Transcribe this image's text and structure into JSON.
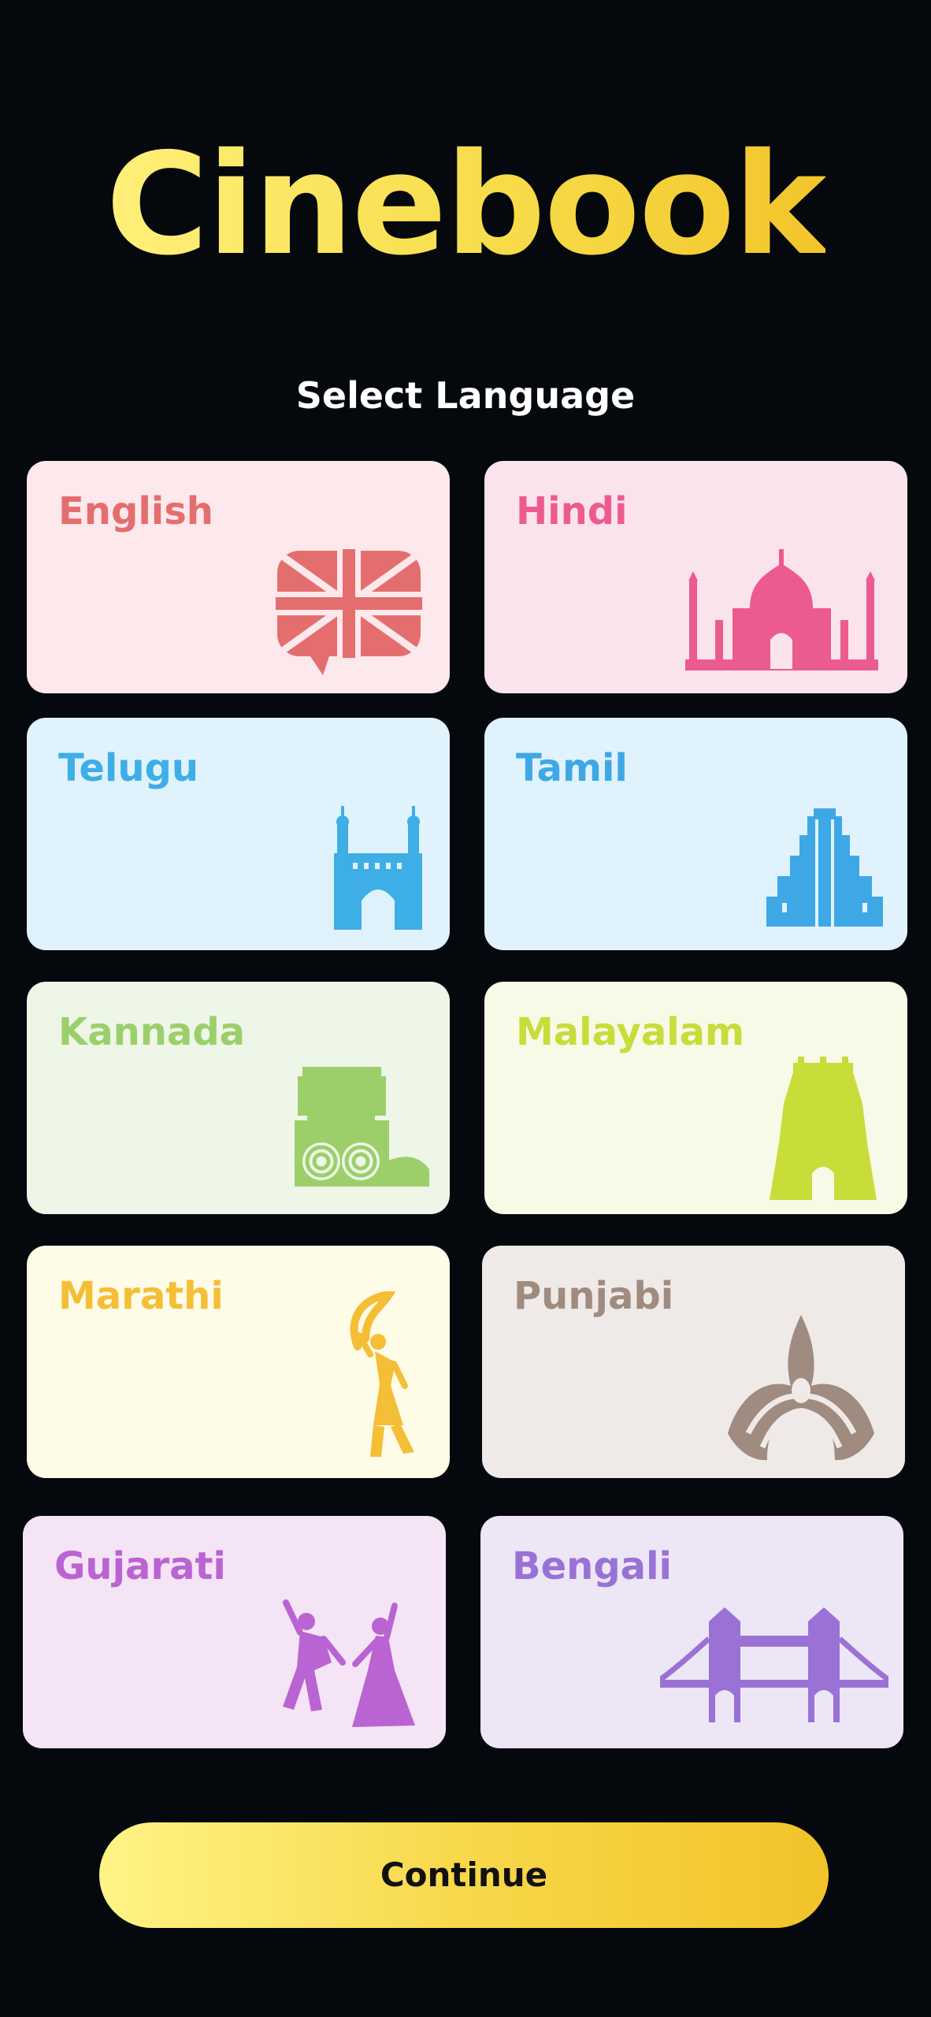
{
  "app": {
    "title": "Cinebook"
  },
  "screen": {
    "subtitle": "Select Language"
  },
  "languages": [
    {
      "label": "English",
      "bg": "#fde8ec",
      "color": "#e46e6e",
      "icon": "uk-flag-speech-bubble-icon"
    },
    {
      "label": "Hindi",
      "bg": "#fbe3ec",
      "color": "#ec5b90",
      "icon": "taj-mahal-icon"
    },
    {
      "label": "Telugu",
      "bg": "#e0f2fc",
      "color": "#3eaee6",
      "icon": "charminar-icon"
    },
    {
      "label": "Tamil",
      "bg": "#e0f2fc",
      "color": "#3ea8e6",
      "icon": "tamil-temple-gopuram-icon"
    },
    {
      "label": "Kannada",
      "bg": "#eef6e8",
      "color": "#9ccf6a",
      "icon": "hampi-stone-chariot-icon"
    },
    {
      "label": "Malayalam",
      "bg": "#f6fae6",
      "color": "#c8dc3a",
      "icon": "kerala-temple-icon"
    },
    {
      "label": "Marathi",
      "bg": "#fefbe6",
      "color": "#f4be36",
      "icon": "lavani-dancer-icon"
    },
    {
      "label": "Punjabi",
      "bg": "#efeae8",
      "color": "#a08b80",
      "icon": "turban-icon"
    },
    {
      "label": "Gujarati",
      "bg": "#f4e4f6",
      "color": "#b964d2",
      "icon": "garba-dancers-icon"
    },
    {
      "label": "Bengali",
      "bg": "#ece6f6",
      "color": "#9a72d6",
      "icon": "howrah-bridge-icon"
    }
  ],
  "actions": {
    "continue_label": "Continue"
  }
}
